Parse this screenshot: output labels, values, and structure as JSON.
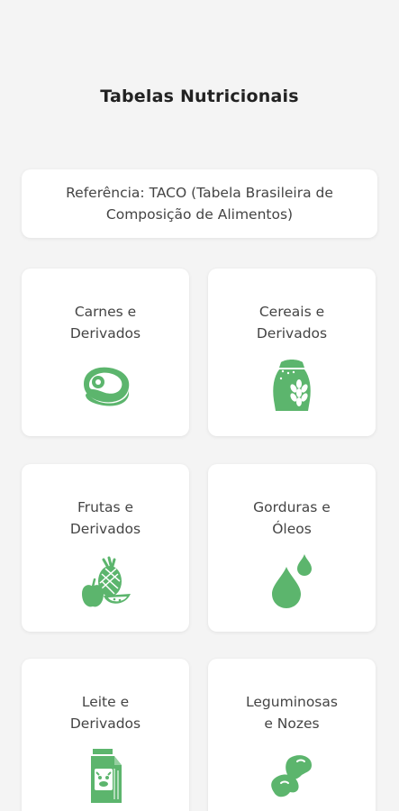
{
  "header": {
    "title": "Tabelas Nutricionais"
  },
  "reference": {
    "text": "Referência: TACO (Tabela Brasileira de Composição de Alimentos)"
  },
  "theme": {
    "accent": "#5cb56d",
    "background": "#f4f4f4",
    "card": "#ffffff"
  },
  "categories": [
    {
      "label": "Carnes e\nDerivados",
      "icon": "meat-steak-icon"
    },
    {
      "label": "Cereais e\nDerivados",
      "icon": "grain-sack-icon"
    },
    {
      "label": "Frutas e\nDerivados",
      "icon": "fruits-icon"
    },
    {
      "label": "Gorduras e\nÓleos",
      "icon": "oil-drops-icon"
    },
    {
      "label": "Leite e\nDerivados",
      "icon": "milk-carton-icon"
    },
    {
      "label": "Leguminosas\ne Nozes",
      "icon": "beans-icon"
    }
  ]
}
